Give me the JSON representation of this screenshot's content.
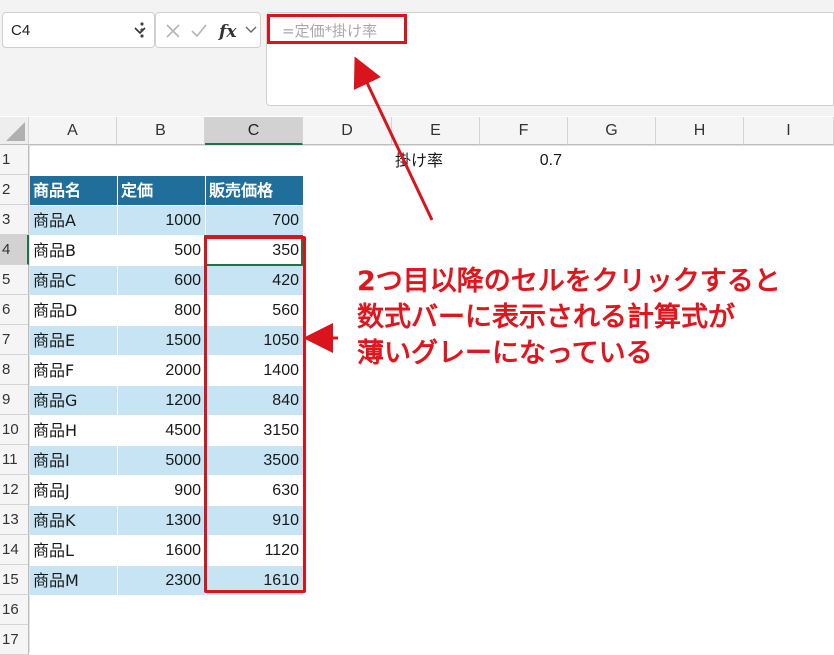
{
  "namebox": {
    "value": "C4"
  },
  "formula_bar": {
    "formula": "=定価*掛け率"
  },
  "columns": [
    "A",
    "B",
    "C",
    "D",
    "E",
    "F",
    "G",
    "H",
    "I"
  ],
  "selected_column": "C",
  "rows": [
    "1",
    "2",
    "3",
    "4",
    "5",
    "6",
    "7",
    "8",
    "9",
    "10",
    "11",
    "12",
    "13",
    "14",
    "15",
    "16",
    "17"
  ],
  "selected_row": "4",
  "params": {
    "label": "掛け率",
    "value": "0.7"
  },
  "table": {
    "headers": [
      "商品名",
      "定価",
      "販売価格"
    ],
    "rows": [
      [
        "商品A",
        "1000",
        "700"
      ],
      [
        "商品B",
        "500",
        "350"
      ],
      [
        "商品C",
        "600",
        "420"
      ],
      [
        "商品D",
        "800",
        "560"
      ],
      [
        "商品E",
        "1500",
        "1050"
      ],
      [
        "商品F",
        "2000",
        "1400"
      ],
      [
        "商品G",
        "1200",
        "840"
      ],
      [
        "商品H",
        "4500",
        "3150"
      ],
      [
        "商品I",
        "5000",
        "3500"
      ],
      [
        "商品J",
        "900",
        "630"
      ],
      [
        "商品K",
        "1300",
        "910"
      ],
      [
        "商品L",
        "1600",
        "1120"
      ],
      [
        "商品M",
        "2300",
        "1610"
      ]
    ]
  },
  "annotation": {
    "lines": [
      "2つ目以降のセルをクリックすると",
      "数式バーに表示される計算式が",
      "薄いグレーになっている"
    ]
  },
  "colors": {
    "header_fill": "#1f6f9a",
    "band_fill": "#c6e4f3",
    "highlight_red": "#d9141d",
    "selection_green": "#217346"
  }
}
